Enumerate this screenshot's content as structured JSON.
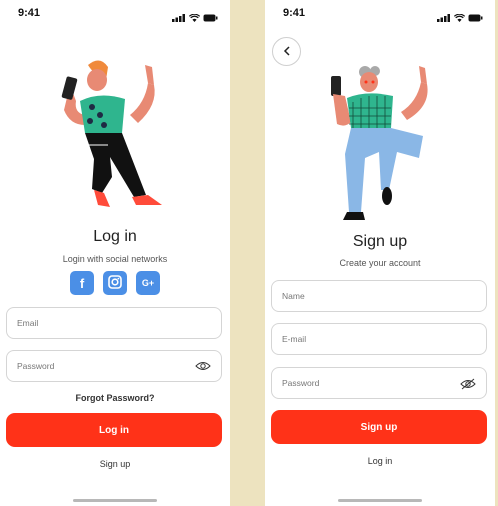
{
  "colors": {
    "accent": "#ff3218",
    "social": "#4b8fe6",
    "background": "#ede3bf"
  },
  "login": {
    "time": "9:41",
    "title": "Log in",
    "subtitle": "Login with social networks",
    "social": [
      {
        "icon": "facebook-icon",
        "glyph": "f"
      },
      {
        "icon": "instagram-icon",
        "glyph": ""
      },
      {
        "icon": "google-plus-icon",
        "glyph": "G+"
      }
    ],
    "email_placeholder": "Email",
    "password_placeholder": "Password",
    "forgot": "Forgot Password?",
    "login_button": "Log in",
    "signup_link": "Sign up"
  },
  "signup": {
    "time": "9:41",
    "title": "Sign up",
    "subtitle": "Create your account",
    "name_placeholder": "Name",
    "email_placeholder": "E-mail",
    "password_placeholder": "Password",
    "signup_button": "Sign up",
    "login_link": "Log in"
  }
}
